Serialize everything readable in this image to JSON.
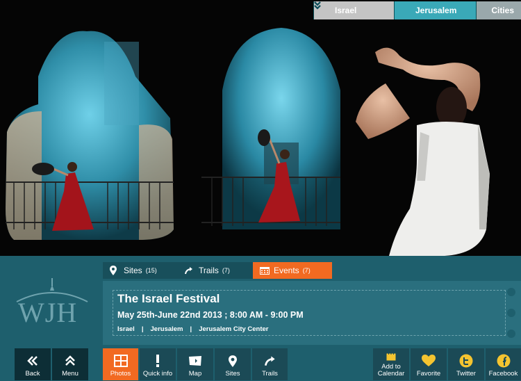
{
  "breadcrumbs": [
    {
      "label": "Israel"
    },
    {
      "label": "Jerusalem"
    },
    {
      "label": "Cities"
    }
  ],
  "logo": {
    "text": "WJH"
  },
  "tabs": {
    "sites": {
      "label": "Sites",
      "count": "(15)"
    },
    "trails": {
      "label": "Trails",
      "count": "(7)"
    },
    "events": {
      "label": "Events",
      "count": "(7)"
    }
  },
  "event": {
    "title": "The Israel Festival",
    "date": "May 25th-June 22nd 2013 ; 8:00 AM - 9:00 PM",
    "location": [
      "Israel",
      "Jerusalem",
      "Jerusalem City Center"
    ],
    "separator": "|"
  },
  "toolbar": {
    "back": "Back",
    "menu": "Menu",
    "photos": "Photos",
    "quick_info": "Quick info",
    "map": "Map",
    "sites": "Sites",
    "trails": "Trails",
    "add_to_calendar": "Add to Calendar",
    "favorite": "Favorite",
    "twitter": "Twitter",
    "facebook": "Facebook"
  },
  "colors": {
    "accent": "#f26a21",
    "panel": "#1e5f6d",
    "crumb_active": "#3aa9b8"
  },
  "icons": {
    "crumb": "chevron-double-down-icon",
    "sites": "map-pin-icon",
    "trails": "trail-arrow-icon",
    "events": "calendar-icon",
    "back": "chevron-double-left-icon",
    "menu": "chevron-double-up-icon",
    "photos": "grid-icon",
    "quick_info": "exclamation-icon",
    "map": "map-icon",
    "favorite": "heart-icon",
    "twitter": "twitter-icon",
    "facebook": "facebook-icon"
  }
}
